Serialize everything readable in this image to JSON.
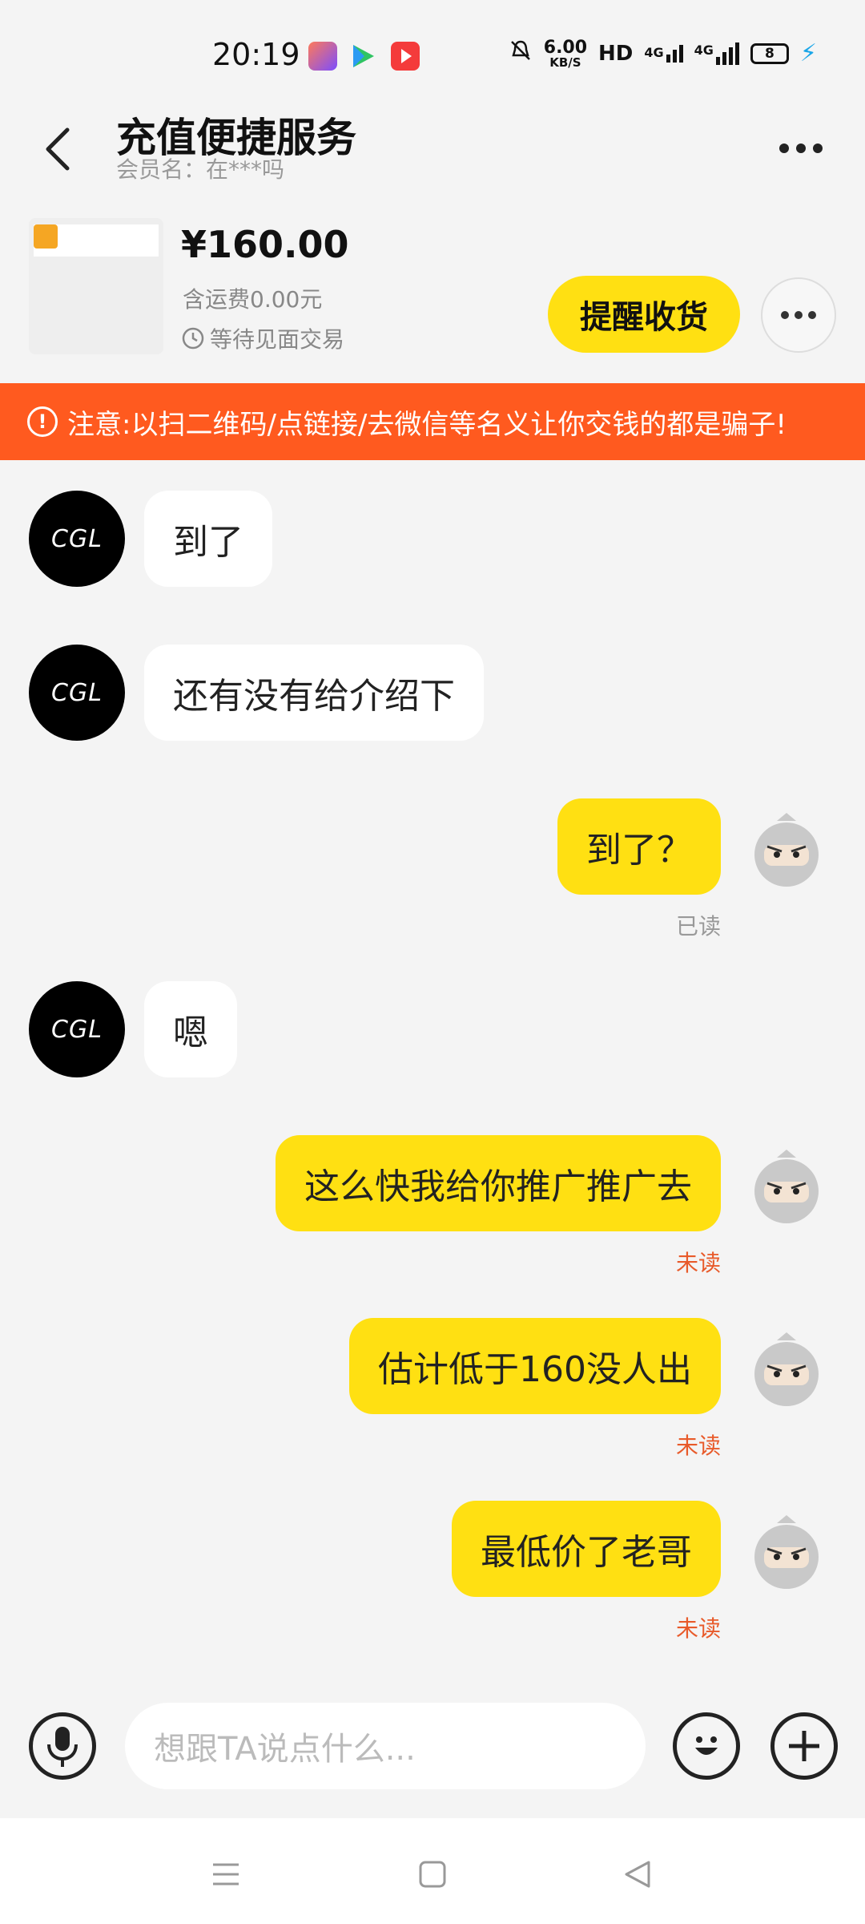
{
  "status_bar": {
    "time": "20:19",
    "speed_value": "6.00",
    "speed_unit": "KB/S",
    "hd": "HD",
    "net1": "4G",
    "net2": "4G",
    "battery": "8",
    "icons": [
      "app-icon-1",
      "video-app-icon",
      "red-app-icon",
      "mute-bell-icon",
      "signal-icon",
      "charging-icon"
    ]
  },
  "header": {
    "title": "充值便捷服务",
    "subtitle": "会员名：在***吗"
  },
  "product": {
    "price": "¥160.00",
    "shipping": "含运费0.00元",
    "status": "等待见面交易",
    "remind_button": "提醒收货"
  },
  "warning": {
    "text": "注意:以扫二维码/点链接/去微信等名义让你交钱的都是骗子!"
  },
  "chat": {
    "other_avatar_text": "CGL",
    "messages": [
      {
        "side": "in",
        "text": "到了"
      },
      {
        "side": "in",
        "text": "还有没有给介绍下"
      },
      {
        "side": "out",
        "text": "到了？",
        "receipt": "已读"
      },
      {
        "side": "in",
        "text": "嗯"
      },
      {
        "side": "out",
        "text": "这么快我给你推广推广去",
        "receipt": "未读"
      },
      {
        "side": "out",
        "text": "估计低于160没人出",
        "receipt": "未读"
      },
      {
        "side": "out",
        "text": "最低价了老哥",
        "receipt": "未读"
      }
    ]
  },
  "input": {
    "placeholder": "想跟TA说点什么..."
  },
  "colors": {
    "accent": "#ffe012",
    "warning": "#ff5a1f",
    "unread": "#e85a2a"
  }
}
